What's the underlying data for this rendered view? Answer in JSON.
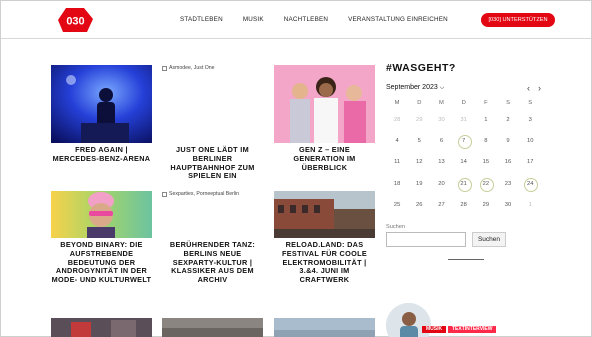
{
  "header": {
    "logo_text": "030",
    "nav": [
      "STADTLEBEN",
      "MUSIK",
      "NACHTLEBEN",
      "VERANSTALTUNG EINREICHEN"
    ],
    "cta": "[030] UNTERSTÜTZEN"
  },
  "cards": [
    {
      "title": "FRED AGAIN | MERCEDES-BENZ-ARENA",
      "alt": ""
    },
    {
      "title": "JUST ONE LÄDT IM BERLINER HAUPTBAHNHOF ZUM SPIELEN EIN",
      "alt": "Asmodee, Just One"
    },
    {
      "title": "GEN Z – EINE GENERATION IM ÜBERBLICK",
      "alt": ""
    },
    {
      "title": "BEYOND BINARY: DIE AUFSTREBENDE BEDEUTUNG DER ANDROGYNITÄT IN DER MODE- UND KULTURWELT",
      "alt": ""
    },
    {
      "title": "BERÜHRENDER TANZ: BERLINS NEUE SEXPARTY-KULTUR | KLASSIKER AUS DEM ARCHIV",
      "alt": "Sexparties, Porneeptual Berlin"
    },
    {
      "title": "RELOAD.LAND: DAS FESTIVAL FÜR COOLE ELEKTROMOBILITÄT | 3.&4. JUNI IM CRAFTWERK",
      "alt": ""
    }
  ],
  "sidebar": {
    "heading": "#WASGEHT?",
    "month": "September 2023",
    "days_of_week": [
      "M",
      "D",
      "M",
      "D",
      "F",
      "S",
      "S"
    ],
    "weeks": [
      [
        "28",
        "29",
        "30",
        "31",
        "1",
        "2",
        "3"
      ],
      [
        "4",
        "5",
        "6",
        "7",
        "8",
        "9",
        "10"
      ],
      [
        "11",
        "12",
        "13",
        "14",
        "15",
        "16",
        "17"
      ],
      [
        "18",
        "19",
        "20",
        "21",
        "22",
        "23",
        "24"
      ],
      [
        "25",
        "26",
        "27",
        "28",
        "29",
        "30",
        "1"
      ]
    ],
    "search_label": "Suchen",
    "search_value": "",
    "search_button": "Suchen",
    "tags": [
      "MUSIK",
      "TEXTINTERVIEW"
    ]
  },
  "colors": {
    "accent": "#e30613",
    "event_ring": "#c6cf9a"
  }
}
